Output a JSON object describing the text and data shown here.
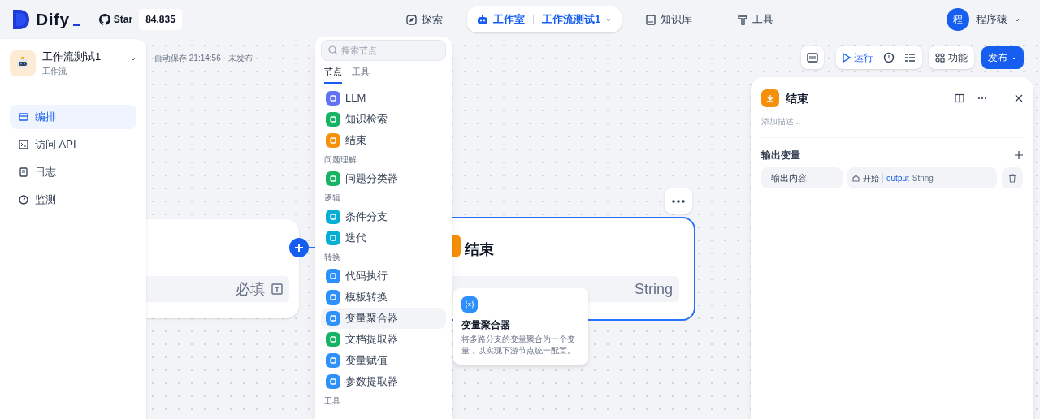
{
  "header": {
    "logo": "Dify",
    "github": {
      "label": "Star",
      "count": "84,835"
    },
    "nav": [
      {
        "label": "探索",
        "selected": false
      },
      {
        "label": "工作室",
        "selected": true,
        "crumb": "工作流测试1"
      },
      {
        "label": "知识库",
        "selected": false
      },
      {
        "label": "工具",
        "selected": false
      }
    ],
    "user": {
      "avatar": "程",
      "name": "程序猿"
    }
  },
  "sidebar": {
    "app": {
      "name": "工作流测试1",
      "type": "工作流"
    },
    "items": [
      {
        "label": "编排",
        "selected": true
      },
      {
        "label": "访问 API",
        "selected": false
      },
      {
        "label": "日志",
        "selected": false
      },
      {
        "label": "监测",
        "selected": false
      }
    ]
  },
  "canvas": {
    "autosave": "自动保存 21:14:56 · 未发布",
    "toolbar": {
      "run": "运行",
      "features": "功能",
      "publish": "发布"
    },
    "start_node": {
      "field_badge": "必填"
    },
    "end_node": {
      "title": "结束",
      "type": "String"
    }
  },
  "node_menu": {
    "search_placeholder": "搜索节点",
    "tabs": [
      {
        "label": "节点",
        "selected": true
      },
      {
        "label": "工具",
        "selected": false
      }
    ],
    "entries": [
      {
        "kind": "node",
        "label": "LLM",
        "color": "#6172f3",
        "hovered": false
      },
      {
        "kind": "node",
        "label": "知识检索",
        "color": "#16b364",
        "hovered": false
      },
      {
        "kind": "node",
        "label": "结束",
        "color": "#f79009",
        "hovered": false
      },
      {
        "kind": "group",
        "label": "问题理解"
      },
      {
        "kind": "node",
        "label": "问题分类器",
        "color": "#16b364",
        "hovered": false
      },
      {
        "kind": "group",
        "label": "逻辑"
      },
      {
        "kind": "node",
        "label": "条件分支",
        "color": "#06aed4",
        "hovered": false
      },
      {
        "kind": "node",
        "label": "迭代",
        "color": "#06aed4",
        "hovered": false
      },
      {
        "kind": "group",
        "label": "转换"
      },
      {
        "kind": "node",
        "label": "代码执行",
        "color": "#2e90fa",
        "hovered": false
      },
      {
        "kind": "node",
        "label": "模板转换",
        "color": "#2e90fa",
        "hovered": false
      },
      {
        "kind": "node",
        "label": "变量聚合器",
        "color": "#2e90fa",
        "hovered": true
      },
      {
        "kind": "node",
        "label": "文档提取器",
        "color": "#16b364",
        "hovered": false
      },
      {
        "kind": "node",
        "label": "变量赋值",
        "color": "#2e90fa",
        "hovered": false
      },
      {
        "kind": "node",
        "label": "参数提取器",
        "color": "#2e90fa",
        "hovered": false
      },
      {
        "kind": "group",
        "label": "工具"
      }
    ]
  },
  "tooltip": {
    "title": "变量聚合器",
    "description": "将多路分支的变量聚合为一个变量，以实现下游节点统一配置。"
  },
  "panel": {
    "title": "结束",
    "description_placeholder": "添加描述...",
    "section": "输出变量",
    "variables": [
      {
        "name": "输出内容",
        "ref_node": "开始",
        "ref_var": "output",
        "type": "String"
      }
    ]
  }
}
